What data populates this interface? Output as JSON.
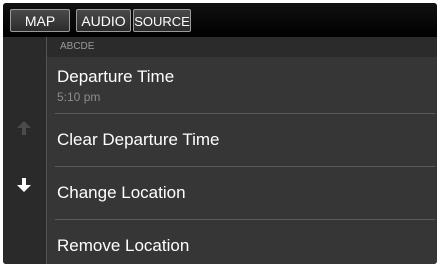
{
  "tabs": {
    "map": "MAP",
    "audio": "AUDIO",
    "source": "SOURCE"
  },
  "header": {
    "breadcrumb": "ABCDE"
  },
  "menu": {
    "items": [
      {
        "label": "Departure Time",
        "sub": "5:10 pm"
      },
      {
        "label": "Clear Departure Time"
      },
      {
        "label": "Change Location"
      },
      {
        "label": "Remove Location"
      }
    ]
  },
  "scroll": {
    "up_icon": "arrow-up-icon",
    "down_icon": "arrow-down-icon"
  }
}
